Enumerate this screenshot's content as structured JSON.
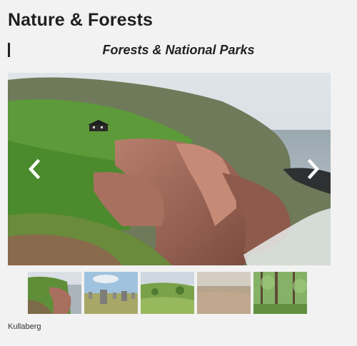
{
  "page": {
    "title": "Nature & Forests",
    "section_heading": "Forests & National Parks"
  },
  "gallery": {
    "prev_icon": "chevron-left-icon",
    "next_icon": "chevron-right-icon",
    "caption": "Kullaberg",
    "thumbnails": [
      {
        "icon": "coastal-cliff-image"
      },
      {
        "icon": "standing-stones-image"
      },
      {
        "icon": "green-meadow-image"
      },
      {
        "icon": "hazy-heath-image"
      },
      {
        "icon": "green-forest-image"
      }
    ]
  },
  "colors": {
    "background": "#f2f2f2",
    "title_text": "#1f1f1f",
    "accent_bar": "#222222"
  }
}
